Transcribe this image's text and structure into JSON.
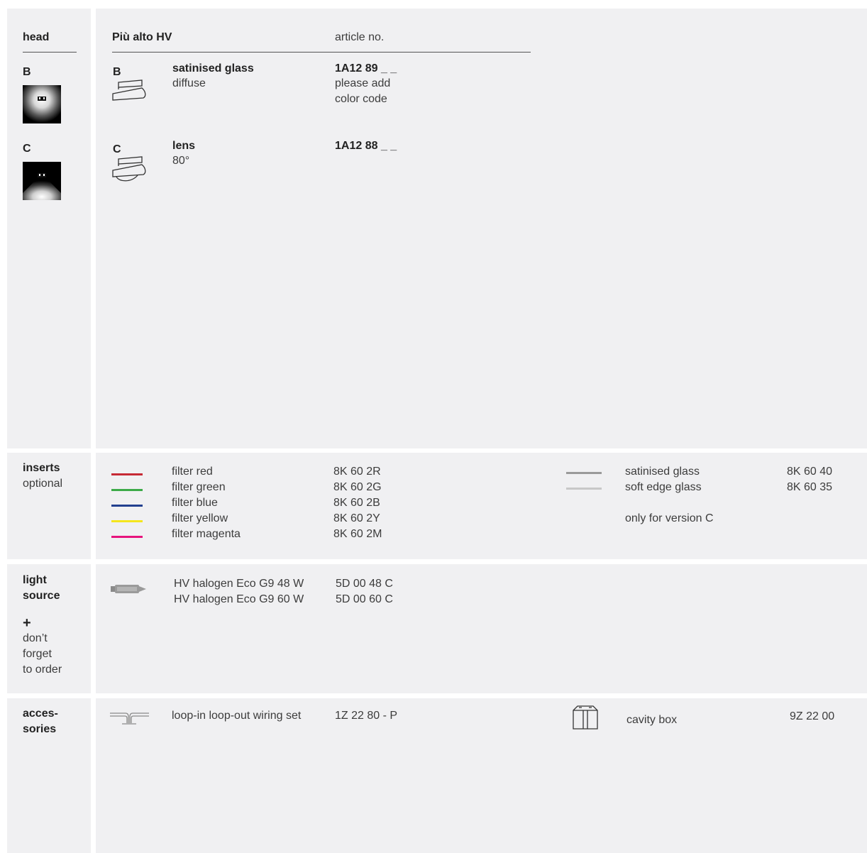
{
  "head": {
    "section_label": "head",
    "product_title": "Più alto HV",
    "article_header": "article no.",
    "versions": [
      {
        "code": "B",
        "name": "satinised glass",
        "sub": "diffuse",
        "article": "1A12 89 _ _",
        "note1": "please add",
        "note2": "color code"
      },
      {
        "code": "C",
        "name": "lens",
        "sub": "80°",
        "article": "1A12 88 _ _"
      }
    ]
  },
  "inserts": {
    "label": "inserts",
    "sublabel": "optional",
    "filters": [
      {
        "name": "filter red",
        "article": "8K 60 2R",
        "color": "#c62a35"
      },
      {
        "name": "filter green",
        "article": "8K 60 2G",
        "color": "#3caa48"
      },
      {
        "name": "filter blue",
        "article": "8K 60 2B",
        "color": "#23408f"
      },
      {
        "name": "filter yellow",
        "article": "8K 60 2Y",
        "color": "#f5e61e"
      },
      {
        "name": "filter magenta",
        "article": "8K 60 2M",
        "color": "#e6147d"
      }
    ],
    "glasses": [
      {
        "name": "satinised glass",
        "article": "8K 60 40",
        "color": "#9a9a9a"
      },
      {
        "name": "soft edge glass",
        "article": "8K 60 35",
        "color": "#c8c8c8"
      }
    ],
    "note": "only for version C"
  },
  "light_source": {
    "label1": "light",
    "label2": "source",
    "plus": "+",
    "remind1": "don’t",
    "remind2": "forget",
    "remind3": "to order",
    "items": [
      {
        "name": "HV halogen Eco G9 48 W",
        "article": "5D 00 48 C"
      },
      {
        "name": "HV halogen Eco G9 60 W",
        "article": "5D 00 60 C"
      }
    ]
  },
  "accessories": {
    "label1": "acces-",
    "label2": "sories",
    "wiring_name": "loop-in loop-out wiring set",
    "wiring_article": "1Z 22 80 - P",
    "cavity_name": "cavity box",
    "cavity_article": "9Z 22 00"
  }
}
